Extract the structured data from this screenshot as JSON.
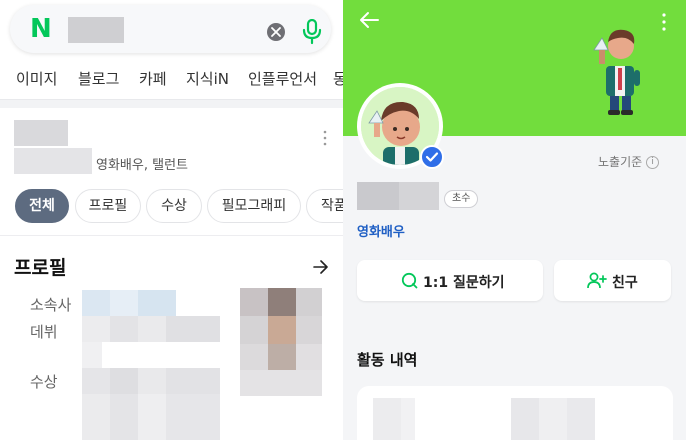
{
  "search": {
    "logo": "N",
    "query": ""
  },
  "tabs": [
    {
      "label": "이미지"
    },
    {
      "label": "블로그"
    },
    {
      "label": "카페"
    },
    {
      "label": "지식iN"
    },
    {
      "label": "인플루언서"
    },
    {
      "label": "동"
    }
  ],
  "person": {
    "occupation": "영화배우, 탤런트"
  },
  "chips": [
    {
      "label": "전체",
      "active": true
    },
    {
      "label": "프로필",
      "active": false
    },
    {
      "label": "수상",
      "active": false
    },
    {
      "label": "필모그래피",
      "active": false
    },
    {
      "label": "작품",
      "active": false
    }
  ],
  "profile": {
    "title": "프로필",
    "labels": [
      "소속사",
      "데뷔",
      "수상"
    ]
  },
  "influencer": {
    "exposure_label": "노출기준",
    "info_symbol": "i",
    "badge": "초수",
    "role": "영화배우",
    "question_button": "1:1 질문하기",
    "friend_button": "친구",
    "activity_title": "활동 내역"
  },
  "colors": {
    "naver_green": "#03c75a",
    "banner_green": "#72dd3d",
    "active_chip": "#5d6b80",
    "verified_blue": "#2f6ee8",
    "role_blue": "#1f5fc4"
  },
  "icons": [
    "naver-logo-icon",
    "clear-icon",
    "mic-icon",
    "more-icon",
    "arrow-right-icon",
    "back-arrow-icon",
    "verified-icon",
    "question-icon",
    "add-friend-icon",
    "info-icon"
  ]
}
